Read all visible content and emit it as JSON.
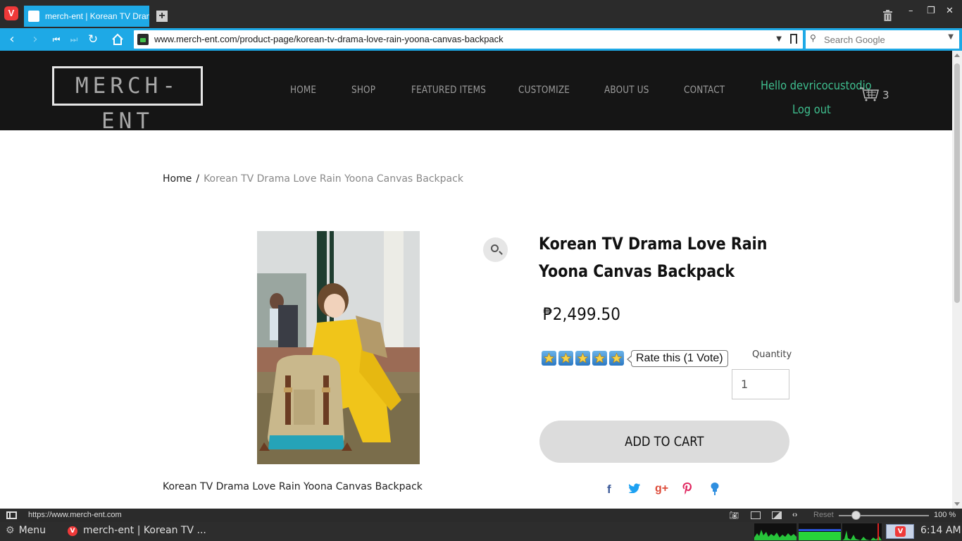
{
  "browser": {
    "tab_title": "merch-ent | Korean TV Drama Love Rain Yoona Canvas Backpack",
    "url": "www.merch-ent.com/product-page/korean-tv-drama-love-rain-yoona-canvas-backpack",
    "search_placeholder": "Search Google",
    "status_url": "https://www.merch-ent.com",
    "zoom_reset_label": "Reset",
    "zoom_level": "100 %",
    "accent_color": "#1ea9e6"
  },
  "site": {
    "logo": "MERCH-ENT",
    "nav": [
      "HOME",
      "SHOP",
      "FEATURED ITEMS",
      "CUSTOMIZE",
      "ABOUT US",
      "CONTACT"
    ],
    "greeting": "Hello devricocustodio",
    "logout": "Log out",
    "cart_count": "3",
    "header_bg": "#151515",
    "link_color": "#3fbf8f"
  },
  "breadcrumb": {
    "home": "Home",
    "separator": "/",
    "current": "Korean TV Drama Love Rain Yoona Canvas Backpack"
  },
  "product": {
    "title": "Korean TV Drama Love Rain Yoona Canvas Backpack",
    "price": "₱2,499.50",
    "rating_stars": 5,
    "rating_label": "Rate this (1 Vote)",
    "quantity_label": "Quantity",
    "quantity_value": "1",
    "add_to_cart": "ADD TO CART",
    "image_caption": "Korean TV Drama Love Rain Yoona Canvas Backpack",
    "share_icons": [
      "facebook-icon",
      "twitter-icon",
      "google-plus-icon",
      "pinterest-icon",
      "pin-icon"
    ]
  },
  "taskbar": {
    "menu_label": "Menu",
    "task_label": "merch-ent | Korean TV ...",
    "clock": "6:14 AM"
  }
}
